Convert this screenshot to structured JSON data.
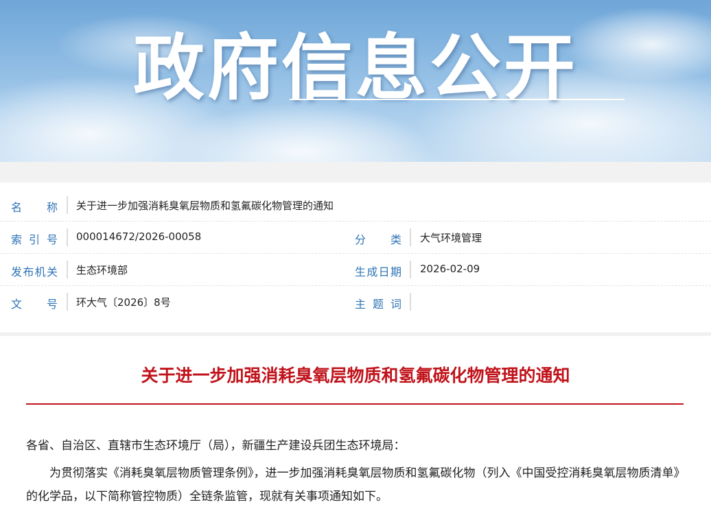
{
  "banner": {
    "title": "政府信息公开"
  },
  "meta": {
    "name_label": "名　　称",
    "name_value": "关于进一步加强消耗臭氧层物质和氢氟碳化物管理的通知",
    "index_label": "索 引 号",
    "index_value": "000014672/2026-00058",
    "category_label": "分　　类",
    "category_value": "大气环境管理",
    "publisher_label": "发布机关",
    "publisher_value": "生态环境部",
    "date_label": "生成日期",
    "date_value": "2026-02-09",
    "docno_label": "文　　号",
    "docno_value": "环大气〔2026〕8号",
    "keywords_label": "主 题 词",
    "keywords_value": ""
  },
  "document": {
    "title": "关于进一步加强消耗臭氧层物质和氢氟碳化物管理的通知",
    "salutation": "各省、自治区、直辖市生态环境厅（局），新疆生产建设兵团生态环境局：",
    "paragraph_1": "为贯彻落实《消耗臭氧层物质管理条例》，进一步加强消耗臭氧层物质和氢氟碳化物（列入《中国受控消耗臭氧层物质清单》的化学品，以下简称管控物质）全链条监管，现就有关事项通知如下。"
  },
  "colors": {
    "accent_blue": "#2e74b5",
    "title_red": "#c0121a"
  }
}
